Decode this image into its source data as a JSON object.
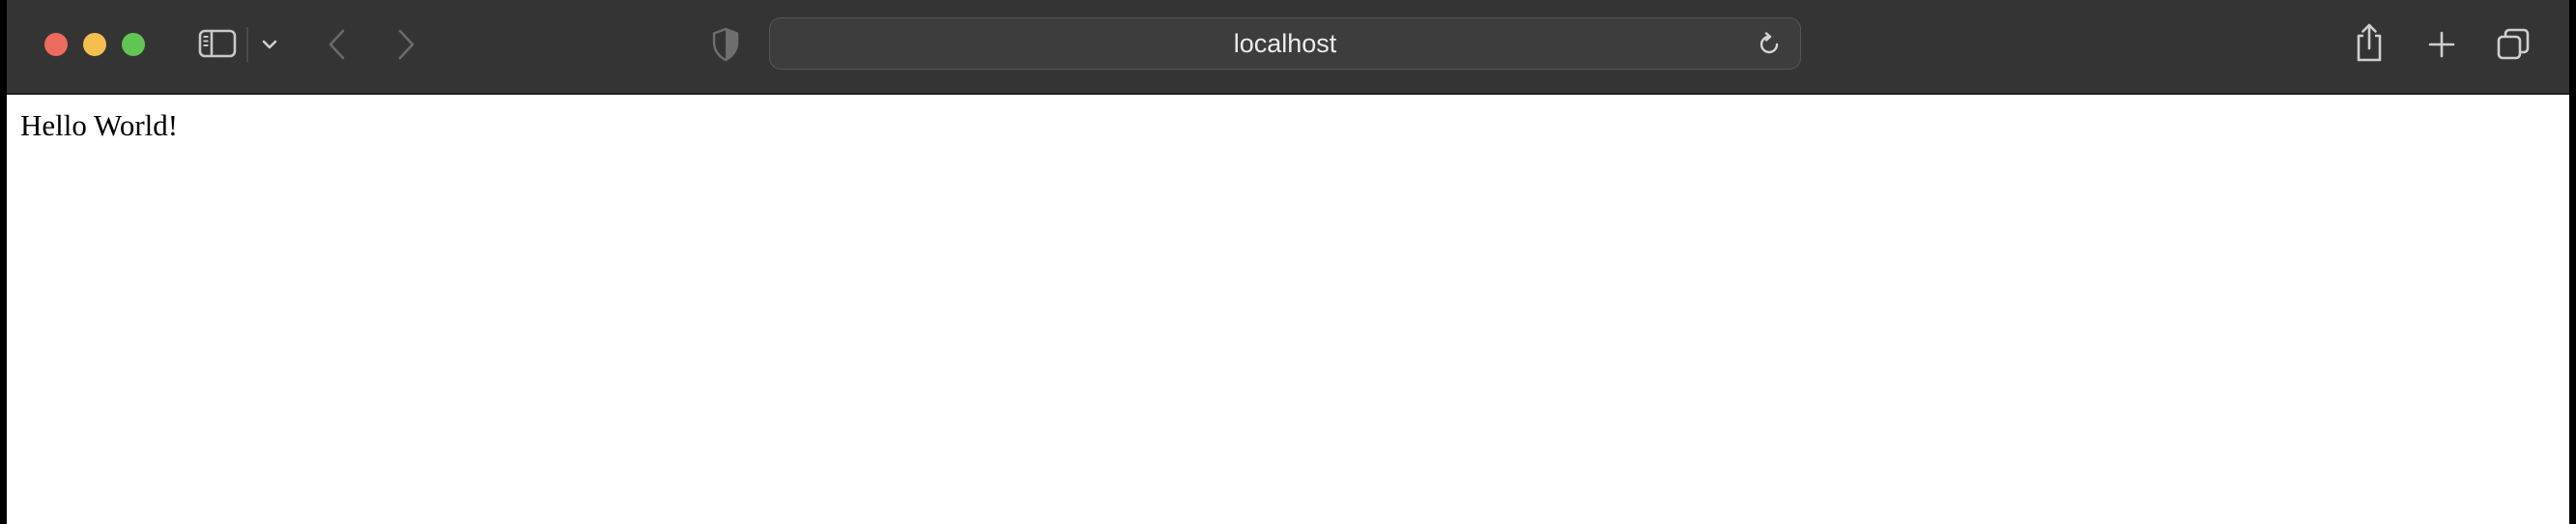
{
  "browser": {
    "window_controls": [
      "close",
      "minimize",
      "maximize"
    ],
    "toolbar": {
      "sidebar_icon": "sidebar-icon",
      "tab_group_icon": "chevron-down-icon",
      "back_icon": "chevron-left-icon",
      "forward_icon": "chevron-right-icon",
      "privacy_icon": "shield-icon",
      "reload_icon": "reload-icon",
      "share_icon": "share-icon",
      "new_tab_icon": "plus-icon",
      "tab_overview_icon": "tab-overview-icon"
    },
    "address_bar": {
      "url": "localhost"
    }
  },
  "page": {
    "body_text": "Hello World!"
  },
  "colors": {
    "toolbar_bg": "#343434",
    "close": "#ed6a5e",
    "minimize": "#f5bf4f",
    "maximize": "#61c554"
  }
}
